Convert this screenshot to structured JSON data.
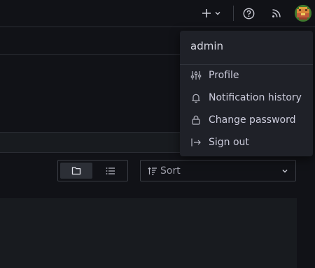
{
  "topbar": {
    "add_icon": "plus-icon",
    "add_caret_icon": "chevron-down-icon",
    "help_icon": "question-circle-icon",
    "news_icon": "rss-icon",
    "avatar_icon": "user-avatar"
  },
  "user_menu": {
    "username": "admin",
    "items": [
      {
        "label": "Profile",
        "icon": "sliders-icon"
      },
      {
        "label": "Notification history",
        "icon": "bell-icon"
      },
      {
        "label": "Change password",
        "icon": "lock-icon"
      },
      {
        "label": "Sign out",
        "icon": "sign-out-icon"
      }
    ]
  },
  "view_toggle": {
    "folder_view_icon": "folder-icon",
    "list_view_icon": "list-icon",
    "active": "folder"
  },
  "sort": {
    "label": "Sort",
    "icon": "sort-amount-up-icon",
    "caret_icon": "chevron-down-icon"
  },
  "colors": {
    "background": "#111217",
    "menu_bg": "#1f2128",
    "panel_bg": "#181b1f",
    "border": "#3a3d44"
  }
}
